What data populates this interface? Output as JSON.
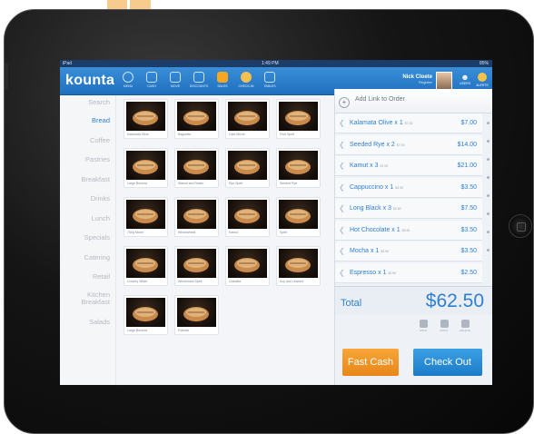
{
  "status": {
    "carrier": "iPad",
    "time": "1:49 PM",
    "battery": "85%"
  },
  "app": {
    "logo": "kounta"
  },
  "toolbar": [
    {
      "label": "Menu",
      "icon": "clock-icon"
    },
    {
      "label": "Cash",
      "icon": "register-icon"
    },
    {
      "label": "Move",
      "icon": "move-icon"
    },
    {
      "label": "Discounts",
      "icon": "discount-icon"
    },
    {
      "label": "Sales",
      "icon": "sales-icon"
    },
    {
      "label": "Check-in",
      "icon": "checkin-icon"
    },
    {
      "label": "Tables",
      "icon": "tables-icon"
    }
  ],
  "user": {
    "name": "Nick Cloete",
    "role": "Register",
    "users_label": "Users",
    "alerts_label": "Alerts"
  },
  "categories": [
    "Search",
    "Bread",
    "Coffee",
    "Pastries",
    "Breakfast",
    "Drinks",
    "Lunch",
    "Specials",
    "Catering",
    "Retail",
    "Kitchen Breakfast",
    "Salads"
  ],
  "active_category": "Bread",
  "products": [
    "Kalamata Olive",
    "Baguette",
    "Cafe Miche",
    "Fruit Spelt",
    "Large Boronia",
    "Walnut and Raisin",
    "Rye Spelt",
    "Seeded Rye",
    "750g Miche",
    "Wholewheat",
    "Kamut",
    "Spelt",
    "Country White",
    "Wholemeal Spelt",
    "Ciabatta",
    "Soy and Linseed",
    "Large Boronia",
    "Polenta"
  ],
  "order": {
    "add_link": "Add Link to Order",
    "items": [
      {
        "name": "Kalamata Olive x 1",
        "unit": "$7.00",
        "price": "$7.00"
      },
      {
        "name": "Seeded Rye x 2",
        "unit": "$7.00",
        "price": "$14.00"
      },
      {
        "name": "Kamut x 3",
        "unit": "$7.00",
        "price": "$21.00"
      },
      {
        "name": "Cappuccino x 1",
        "unit": "$3.50",
        "price": "$3.50"
      },
      {
        "name": "Long Black x 3",
        "unit": "$2.50",
        "price": "$7.50"
      },
      {
        "name": "Hot Chocolate x 1",
        "unit": "$3.50",
        "price": "$3.50"
      },
      {
        "name": "Mocha x 1",
        "unit": "$3.50",
        "price": "$3.50"
      },
      {
        "name": "Espresso x 1",
        "unit": "$2.50",
        "price": "$2.50"
      }
    ],
    "total_label": "Total",
    "total_value": "$62.50",
    "actions": [
      "Hold",
      "Print",
      "Delete"
    ],
    "fast_cash": "Fast Cash",
    "check_out": "Check Out"
  },
  "colors": {
    "accent": "#2f7fd0",
    "toolbar": "#1f6fbf",
    "fast_cash": "#f29a2a",
    "check_out": "#2a8edb"
  }
}
